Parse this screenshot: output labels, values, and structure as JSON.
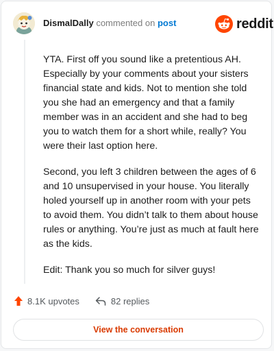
{
  "comment": {
    "username": "DismalDally",
    "action_text": "commented on",
    "post_link": "post",
    "paragraphs": [
      "YTA. First off you sound like a pretentious AH. Especially by your comments about your sisters financial state and kids. Not to mention she told you she had an emergency and that a family member was in an accident and she had to beg you to watch them for a short while, really? You were their last option here.",
      "Second, you left 3 children between the ages of 6 and 10 unsupervised in your house. You literally holed yourself up in another room with your pets to avoid them. You didn’t talk to them about house rules or anything. You’re just as much at fault here as the kids.",
      "Edit: Thank you so much for silver guys!"
    ]
  },
  "brand": {
    "wordmark": "reddit",
    "color": "#ff4500",
    "icon": "reddit-snoo-icon"
  },
  "stats": {
    "upvotes": "8.1K upvotes",
    "replies": "82 replies",
    "upvote_icon": "upvote-arrow-icon",
    "reply_icon": "reply-arrow-icon",
    "upvote_color": "#ff4500"
  },
  "cta": {
    "label": "View the conversation",
    "color": "#d93a00"
  }
}
